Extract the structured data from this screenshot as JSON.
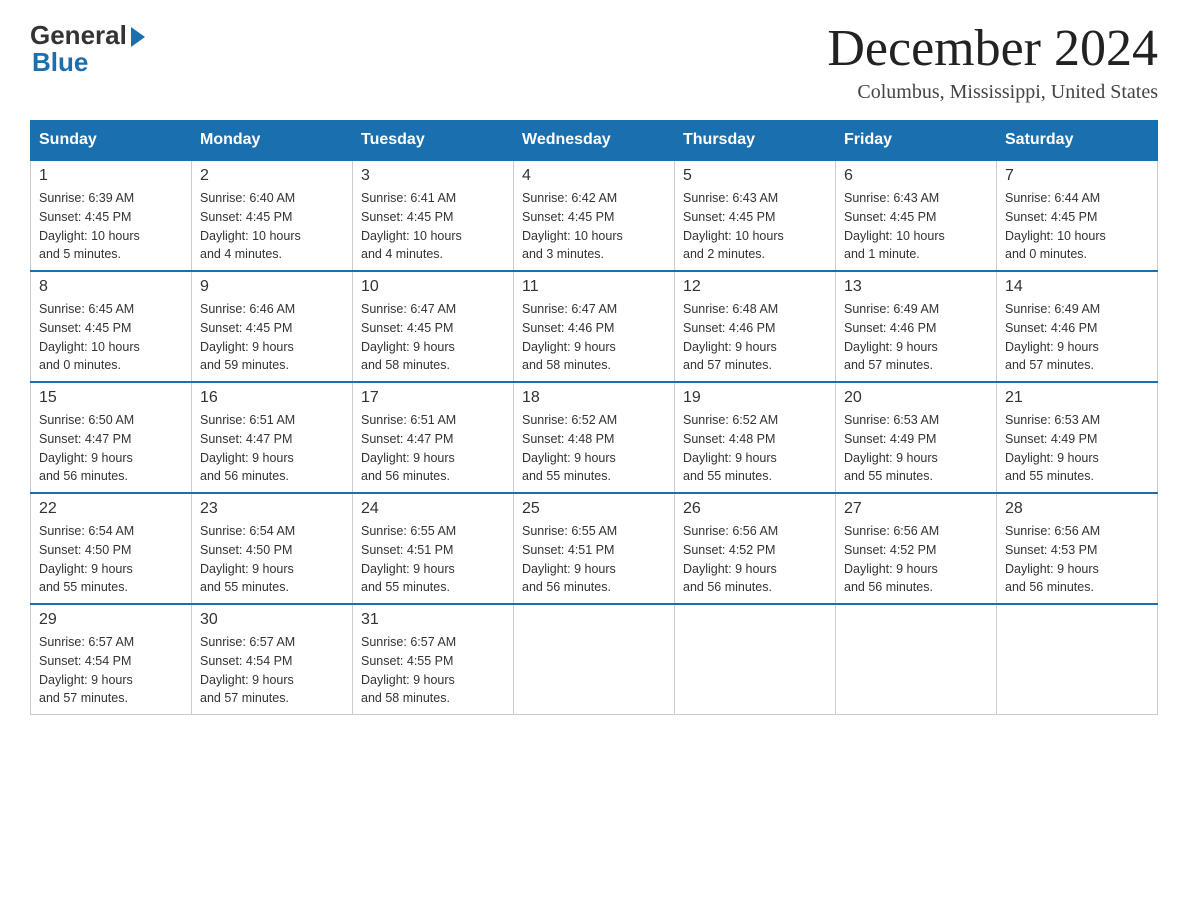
{
  "logo": {
    "general": "General",
    "blue": "Blue"
  },
  "header": {
    "month": "December 2024",
    "location": "Columbus, Mississippi, United States"
  },
  "weekdays": [
    "Sunday",
    "Monday",
    "Tuesday",
    "Wednesday",
    "Thursday",
    "Friday",
    "Saturday"
  ],
  "weeks": [
    [
      {
        "day": "1",
        "sunrise": "6:39 AM",
        "sunset": "4:45 PM",
        "daylight": "10 hours and 5 minutes."
      },
      {
        "day": "2",
        "sunrise": "6:40 AM",
        "sunset": "4:45 PM",
        "daylight": "10 hours and 4 minutes."
      },
      {
        "day": "3",
        "sunrise": "6:41 AM",
        "sunset": "4:45 PM",
        "daylight": "10 hours and 4 minutes."
      },
      {
        "day": "4",
        "sunrise": "6:42 AM",
        "sunset": "4:45 PM",
        "daylight": "10 hours and 3 minutes."
      },
      {
        "day": "5",
        "sunrise": "6:43 AM",
        "sunset": "4:45 PM",
        "daylight": "10 hours and 2 minutes."
      },
      {
        "day": "6",
        "sunrise": "6:43 AM",
        "sunset": "4:45 PM",
        "daylight": "10 hours and 1 minute."
      },
      {
        "day": "7",
        "sunrise": "6:44 AM",
        "sunset": "4:45 PM",
        "daylight": "10 hours and 0 minutes."
      }
    ],
    [
      {
        "day": "8",
        "sunrise": "6:45 AM",
        "sunset": "4:45 PM",
        "daylight": "10 hours and 0 minutes."
      },
      {
        "day": "9",
        "sunrise": "6:46 AM",
        "sunset": "4:45 PM",
        "daylight": "9 hours and 59 minutes."
      },
      {
        "day": "10",
        "sunrise": "6:47 AM",
        "sunset": "4:45 PM",
        "daylight": "9 hours and 58 minutes."
      },
      {
        "day": "11",
        "sunrise": "6:47 AM",
        "sunset": "4:46 PM",
        "daylight": "9 hours and 58 minutes."
      },
      {
        "day": "12",
        "sunrise": "6:48 AM",
        "sunset": "4:46 PM",
        "daylight": "9 hours and 57 minutes."
      },
      {
        "day": "13",
        "sunrise": "6:49 AM",
        "sunset": "4:46 PM",
        "daylight": "9 hours and 57 minutes."
      },
      {
        "day": "14",
        "sunrise": "6:49 AM",
        "sunset": "4:46 PM",
        "daylight": "9 hours and 57 minutes."
      }
    ],
    [
      {
        "day": "15",
        "sunrise": "6:50 AM",
        "sunset": "4:47 PM",
        "daylight": "9 hours and 56 minutes."
      },
      {
        "day": "16",
        "sunrise": "6:51 AM",
        "sunset": "4:47 PM",
        "daylight": "9 hours and 56 minutes."
      },
      {
        "day": "17",
        "sunrise": "6:51 AM",
        "sunset": "4:47 PM",
        "daylight": "9 hours and 56 minutes."
      },
      {
        "day": "18",
        "sunrise": "6:52 AM",
        "sunset": "4:48 PM",
        "daylight": "9 hours and 55 minutes."
      },
      {
        "day": "19",
        "sunrise": "6:52 AM",
        "sunset": "4:48 PM",
        "daylight": "9 hours and 55 minutes."
      },
      {
        "day": "20",
        "sunrise": "6:53 AM",
        "sunset": "4:49 PM",
        "daylight": "9 hours and 55 minutes."
      },
      {
        "day": "21",
        "sunrise": "6:53 AM",
        "sunset": "4:49 PM",
        "daylight": "9 hours and 55 minutes."
      }
    ],
    [
      {
        "day": "22",
        "sunrise": "6:54 AM",
        "sunset": "4:50 PM",
        "daylight": "9 hours and 55 minutes."
      },
      {
        "day": "23",
        "sunrise": "6:54 AM",
        "sunset": "4:50 PM",
        "daylight": "9 hours and 55 minutes."
      },
      {
        "day": "24",
        "sunrise": "6:55 AM",
        "sunset": "4:51 PM",
        "daylight": "9 hours and 55 minutes."
      },
      {
        "day": "25",
        "sunrise": "6:55 AM",
        "sunset": "4:51 PM",
        "daylight": "9 hours and 56 minutes."
      },
      {
        "day": "26",
        "sunrise": "6:56 AM",
        "sunset": "4:52 PM",
        "daylight": "9 hours and 56 minutes."
      },
      {
        "day": "27",
        "sunrise": "6:56 AM",
        "sunset": "4:52 PM",
        "daylight": "9 hours and 56 minutes."
      },
      {
        "day": "28",
        "sunrise": "6:56 AM",
        "sunset": "4:53 PM",
        "daylight": "9 hours and 56 minutes."
      }
    ],
    [
      {
        "day": "29",
        "sunrise": "6:57 AM",
        "sunset": "4:54 PM",
        "daylight": "9 hours and 57 minutes."
      },
      {
        "day": "30",
        "sunrise": "6:57 AM",
        "sunset": "4:54 PM",
        "daylight": "9 hours and 57 minutes."
      },
      {
        "day": "31",
        "sunrise": "6:57 AM",
        "sunset": "4:55 PM",
        "daylight": "9 hours and 58 minutes."
      },
      null,
      null,
      null,
      null
    ]
  ],
  "labels": {
    "sunrise": "Sunrise:",
    "sunset": "Sunset:",
    "daylight": "Daylight:"
  }
}
